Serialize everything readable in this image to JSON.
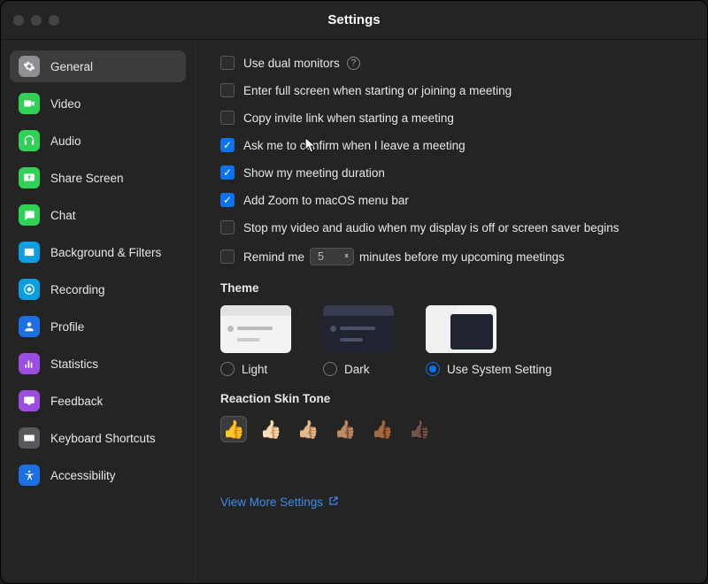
{
  "header": {
    "title": "Settings"
  },
  "sidebar": {
    "items": [
      {
        "label": "General",
        "icon": "gear",
        "color": "#8e8e93",
        "selected": true
      },
      {
        "label": "Video",
        "icon": "video",
        "color": "#31d158",
        "selected": false
      },
      {
        "label": "Audio",
        "icon": "headphones",
        "color": "#31d158",
        "selected": false
      },
      {
        "label": "Share Screen",
        "icon": "share-screen",
        "color": "#31d158",
        "selected": false
      },
      {
        "label": "Chat",
        "icon": "chat",
        "color": "#31d158",
        "selected": false
      },
      {
        "label": "Background & Filters",
        "icon": "background",
        "color": "#0e9de0",
        "selected": false
      },
      {
        "label": "Recording",
        "icon": "recording",
        "color": "#0e9de0",
        "selected": false
      },
      {
        "label": "Profile",
        "icon": "profile",
        "color": "#1d6fe4",
        "selected": false
      },
      {
        "label": "Statistics",
        "icon": "statistics",
        "color": "#9b4de0",
        "selected": false
      },
      {
        "label": "Feedback",
        "icon": "feedback",
        "color": "#9b4de0",
        "selected": false
      },
      {
        "label": "Keyboard Shortcuts",
        "icon": "keyboard",
        "color": "#58585c",
        "selected": false
      },
      {
        "label": "Accessibility",
        "icon": "accessibility",
        "color": "#1d6fe4",
        "selected": false
      }
    ]
  },
  "general": {
    "settings": [
      {
        "label": "Use dual monitors",
        "checked": false,
        "help": true
      },
      {
        "label": "Enter full screen when starting or joining a meeting",
        "checked": false
      },
      {
        "label": "Copy invite link when starting a meeting",
        "checked": false
      },
      {
        "label": "Ask me to confirm when I leave a meeting",
        "checked": true
      },
      {
        "label": "Show my meeting duration",
        "checked": true
      },
      {
        "label": "Add Zoom to macOS menu bar",
        "checked": true
      },
      {
        "label": "Stop my video and audio when my display is off or screen saver begins",
        "checked": false
      }
    ],
    "remind": {
      "prefix": "Remind me",
      "value": "5",
      "suffix": "minutes before my upcoming meetings",
      "checked": false
    },
    "theme": {
      "title": "Theme",
      "options": [
        {
          "label": "Light",
          "selected": false
        },
        {
          "label": "Dark",
          "selected": false
        },
        {
          "label": "Use System Setting",
          "selected": true
        }
      ]
    },
    "skin_tone": {
      "title": "Reaction Skin Tone",
      "options": [
        "👍",
        "👍🏻",
        "👍🏼",
        "👍🏽",
        "👍🏾",
        "👍🏿"
      ],
      "selected_index": 0
    },
    "view_more": "View More Settings"
  }
}
